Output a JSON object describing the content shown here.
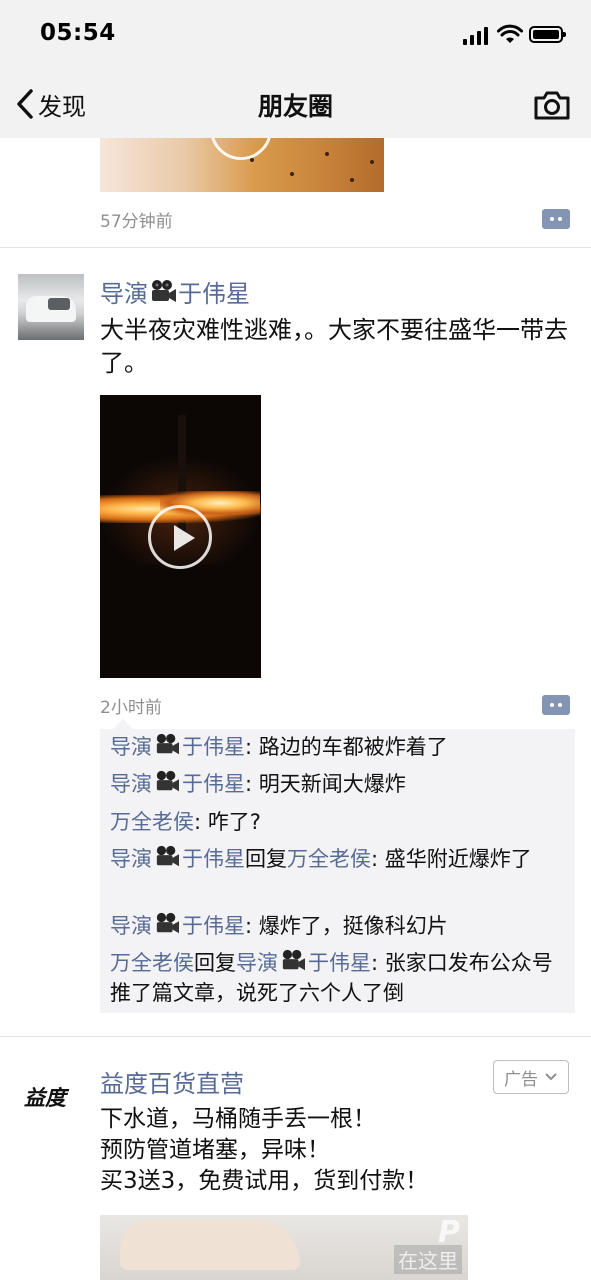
{
  "status_bar": {
    "time": "05:54"
  },
  "nav": {
    "back_label": "发现",
    "title": "朋友圈"
  },
  "prev_post": {
    "time": "57分钟前"
  },
  "post": {
    "author_name_a": "导演",
    "author_name_b": "于伟星",
    "text": "大半夜灾难性逃难，。大家不要往盛华一带去了。",
    "time": "2小时前",
    "comments": [
      {
        "name_a": "导演",
        "name_b": "于伟星",
        "text": ": 路边的车都被炸着了"
      },
      {
        "name_a": "导演",
        "name_b": "于伟星",
        "text": ": 明天新闻大爆炸"
      },
      {
        "name": "万全老侯",
        "text": ": 咋了?"
      },
      {
        "name_a": "导演",
        "name_b": "于伟星",
        "reply_word": "回复",
        "reply_to": "万全老侯",
        "text": ": 盛华附近爆炸了"
      },
      {
        "name_a": "导演",
        "name_b": "于伟星",
        "text": ": 爆炸了，挺像科幻片"
      },
      {
        "name": "万全老侯",
        "reply_word": "回复",
        "reply_to_a": "导演",
        "reply_to_b": "于伟星",
        "text": ": 张家口发布公众号推了篇文章，说死了六个人了倒"
      }
    ]
  },
  "ad": {
    "logo": "益度",
    "name": "益度百货直营",
    "badge": "广告",
    "lines": [
      "下水道，马桶随手丢一根！",
      "预防管道堵塞，异味！",
      "买3送3，免费试用，货到付款！"
    ],
    "watermark_a": "P",
    "watermark_b": "在这里"
  },
  "icons": {
    "back": "chevron-left-icon",
    "camera": "camera-icon",
    "comment": "comment-dots-icon",
    "emoji": "movie-camera-icon"
  },
  "colors": {
    "link": "#576b95",
    "bar_bg": "#f2f2f2",
    "comment_bg": "#f3f3f5",
    "meta": "#8f8f8f"
  }
}
